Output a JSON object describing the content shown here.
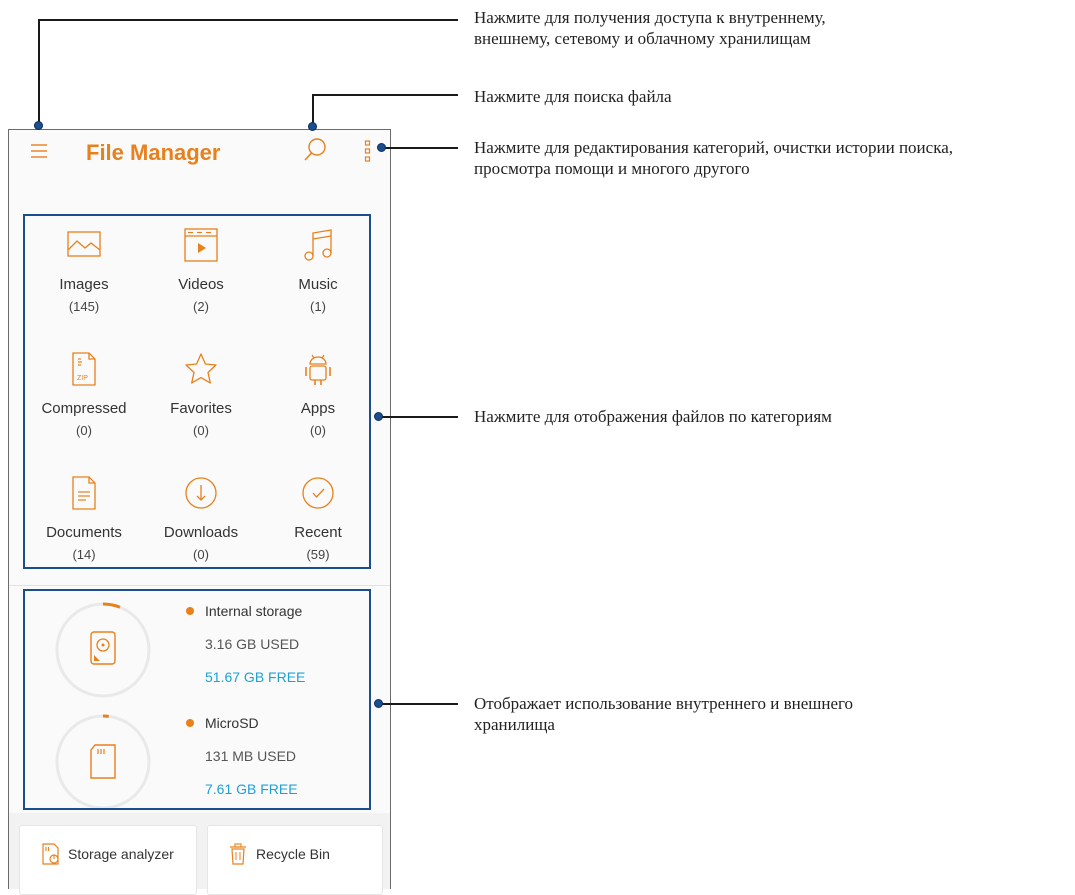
{
  "app": {
    "title": "File Manager"
  },
  "categories": [
    {
      "label": "Images",
      "count": "(145)",
      "icon": "image-icon"
    },
    {
      "label": "Videos",
      "count": "(2)",
      "icon": "video-icon"
    },
    {
      "label": "Music",
      "count": "(1)",
      "icon": "music-icon"
    },
    {
      "label": "Compressed",
      "count": "(0)",
      "icon": "zip-file-icon"
    },
    {
      "label": "Favorites",
      "count": "(0)",
      "icon": "star-icon"
    },
    {
      "label": "Apps",
      "count": "(0)",
      "icon": "android-icon"
    },
    {
      "label": "Documents",
      "count": "(14)",
      "icon": "document-icon"
    },
    {
      "label": "Downloads",
      "count": "(0)",
      "icon": "download-icon"
    },
    {
      "label": "Recent",
      "count": "(59)",
      "icon": "check-circle-icon"
    }
  ],
  "zip_badge": "ZIP",
  "storage": [
    {
      "name": "Internal storage",
      "used": "3.16 GB USED",
      "free": "51.67 GB FREE",
      "used_fraction": 0.06,
      "icon": "hard-drive-icon"
    },
    {
      "name": "MicroSD",
      "used": "131 MB USED",
      "free": "7.61 GB FREE",
      "used_fraction": 0.02,
      "icon": "sd-card-icon"
    }
  ],
  "bottom": {
    "analyzer": "Storage analyzer",
    "recycle": "Recycle Bin"
  },
  "callouts": {
    "menu": "Нажмите для получения доступа к внутреннему,\nвнешнему, сетевому и облачному хранилищам",
    "search": "Нажмите для поиска файла",
    "more": "Нажмите для редактирования категорий, очистки истории поиска,\nпросмотра помощи и многого другого",
    "categories": "Нажмите для отображения файлов по категориям",
    "storage": "Отображает использование внутреннего и внешнего\nхранилища"
  },
  "colors": {
    "accent": "#e8801c",
    "free": "#1ba3d6",
    "highlight": "#1a4e8e"
  }
}
